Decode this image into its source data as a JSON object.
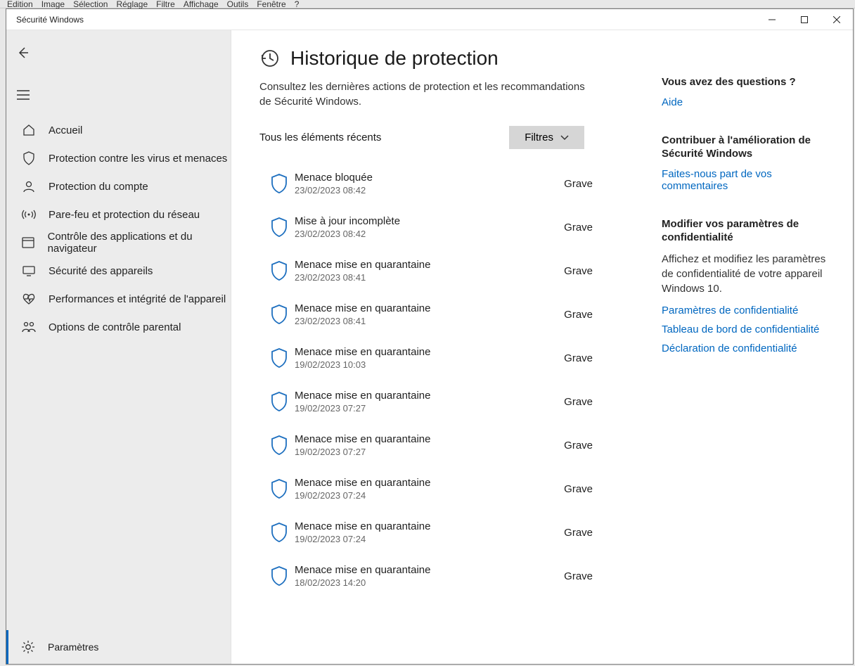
{
  "menubar": [
    "Edition",
    "Image",
    "Sélection",
    "Réglage",
    "Filtre",
    "Affichage",
    "Outils",
    "Fenêtre",
    "?"
  ],
  "window": {
    "title": "Sécurité Windows"
  },
  "sidebar": {
    "items": [
      {
        "label": "Accueil",
        "icon": "home"
      },
      {
        "label": "Protection contre les virus et menaces",
        "icon": "shield"
      },
      {
        "label": "Protection du compte",
        "icon": "person"
      },
      {
        "label": "Pare-feu et protection du réseau",
        "icon": "antenna"
      },
      {
        "label": "Contrôle des applications et du navigateur",
        "icon": "app"
      },
      {
        "label": "Sécurité des appareils",
        "icon": "device"
      },
      {
        "label": "Performances et intégrité de l'appareil",
        "icon": "heart"
      },
      {
        "label": "Options de contrôle parental",
        "icon": "family"
      }
    ],
    "settings_label": "Paramètres"
  },
  "page": {
    "title": "Historique de protection",
    "subtitle": "Consultez les dernières actions de protection et les recommandations de Sécurité Windows.",
    "filter_row_label": "Tous les éléments récents",
    "filter_button": "Filtres"
  },
  "events": [
    {
      "title": "Menace bloquée",
      "time": "23/02/2023 08:42",
      "severity": "Grave"
    },
    {
      "title": "Mise à jour incomplète",
      "time": "23/02/2023 08:42",
      "severity": "Grave"
    },
    {
      "title": "Menace mise en quarantaine",
      "time": "23/02/2023 08:41",
      "severity": "Grave"
    },
    {
      "title": "Menace mise en quarantaine",
      "time": "23/02/2023 08:41",
      "severity": "Grave"
    },
    {
      "title": "Menace mise en quarantaine",
      "time": "19/02/2023 10:03",
      "severity": "Grave"
    },
    {
      "title": "Menace mise en quarantaine",
      "time": "19/02/2023 07:27",
      "severity": "Grave"
    },
    {
      "title": "Menace mise en quarantaine",
      "time": "19/02/2023 07:27",
      "severity": "Grave"
    },
    {
      "title": "Menace mise en quarantaine",
      "time": "19/02/2023 07:24",
      "severity": "Grave"
    },
    {
      "title": "Menace mise en quarantaine",
      "time": "19/02/2023 07:24",
      "severity": "Grave"
    },
    {
      "title": "Menace mise en quarantaine",
      "time": "18/02/2023 14:20",
      "severity": "Grave"
    }
  ],
  "right": {
    "questions_heading": "Vous avez des questions ?",
    "help_link": "Aide",
    "contribute_heading": "Contribuer à l'amélioration de Sécurité Windows",
    "feedback_link": "Faites-nous part de vos commentaires",
    "privacy_heading": "Modifier vos paramètres de confidentialité",
    "privacy_text": "Affichez et modifiez les paramètres de confidentialité de votre appareil Windows 10.",
    "privacy_link1": "Paramètres de confidentialité",
    "privacy_link2": "Tableau de bord de confidentialité",
    "privacy_link3": "Déclaration de confidentialité"
  }
}
